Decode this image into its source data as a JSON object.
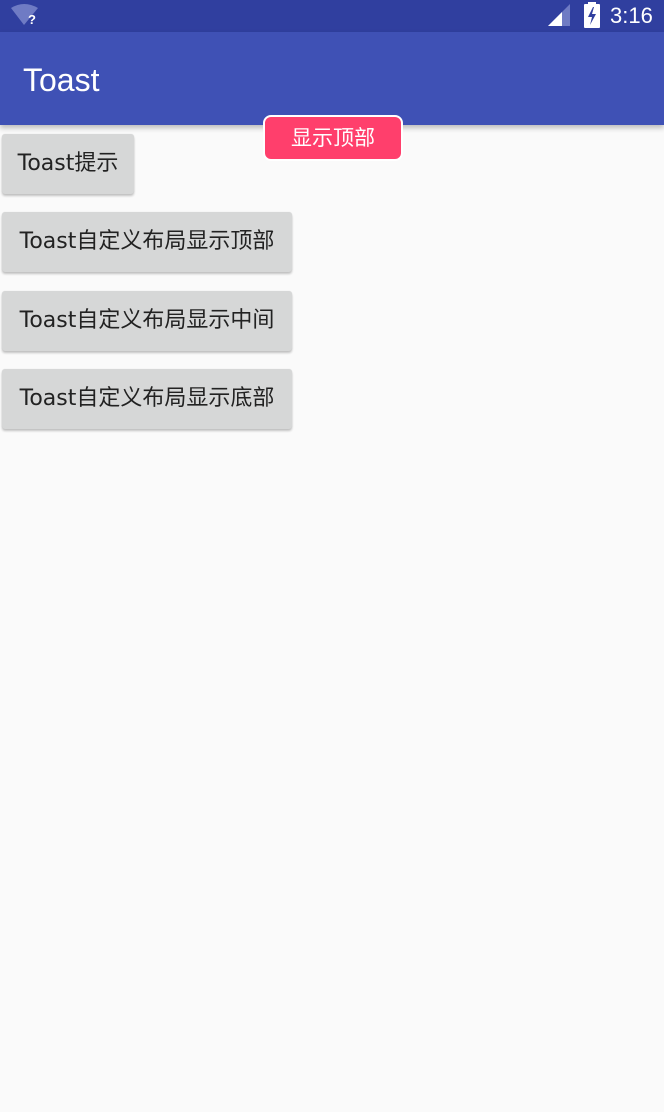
{
  "status_bar": {
    "time": "3:16",
    "wifi_icon": "wifi-unknown-icon",
    "signal_icon": "cell-signal-icon",
    "battery_icon": "battery-charging-icon"
  },
  "app_bar": {
    "title": "Toast"
  },
  "buttons": {
    "toast": "Toast提示",
    "custom_top": "Toast自定义布局显示顶部",
    "custom_center": "Toast自定义布局显示中间",
    "custom_bottom": "Toast自定义布局显示底部"
  },
  "toast": {
    "message": "显示顶部"
  },
  "colors": {
    "status_bar": "#303f9f",
    "app_bar": "#3f51b5",
    "background": "#fafafa",
    "button": "#d6d7d7",
    "toast": "#ff3f6c"
  }
}
